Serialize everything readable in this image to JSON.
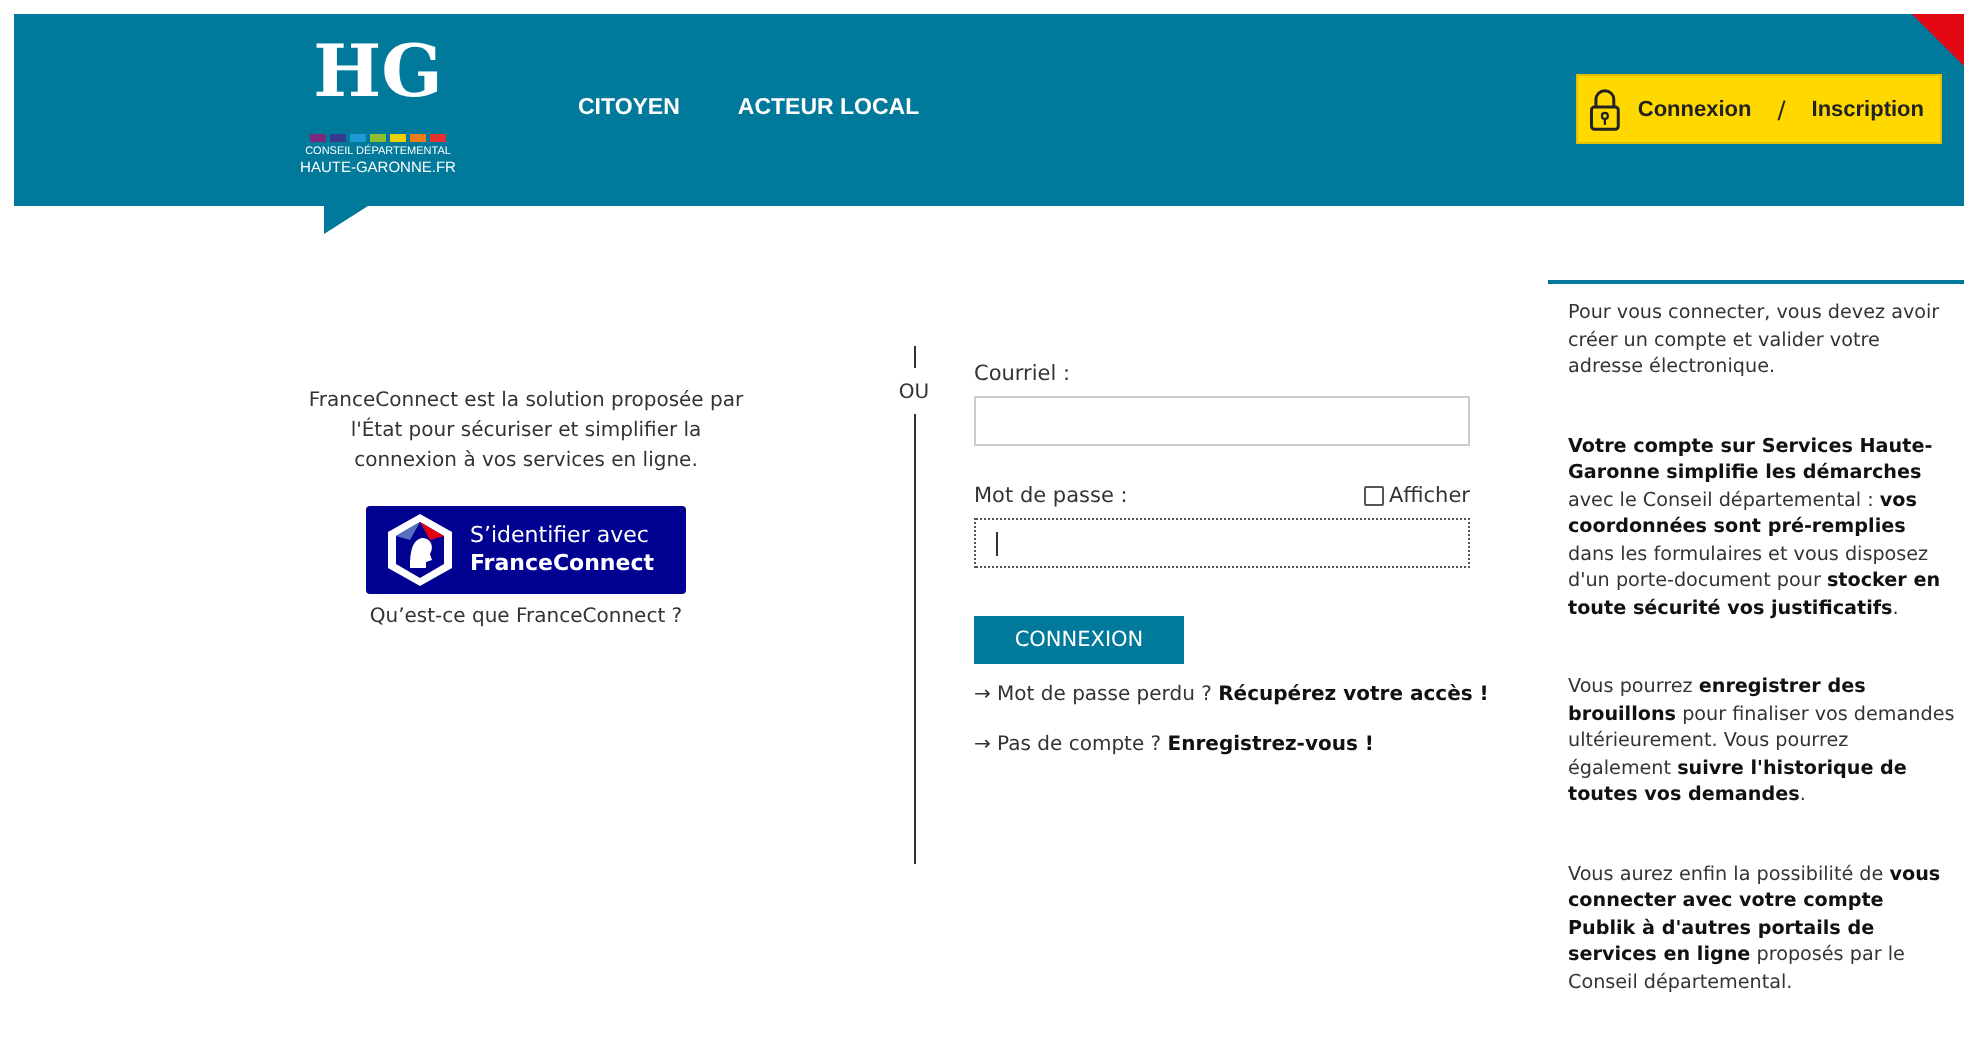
{
  "header": {
    "logo": {
      "mark": "HG",
      "line_1": "CONSEIL DÉPARTEMENTAL",
      "line_2": "HAUTE-GARONNE.FR"
    },
    "nav": [
      {
        "label": "CITOYEN"
      },
      {
        "label": "ACTEUR LOCAL"
      }
    ],
    "account": {
      "login": "Connexion",
      "separator": "/",
      "register": "Inscription"
    }
  },
  "franceconnect": {
    "intro": "FranceConnect est la solution proposée par l'État pour sécuriser et simplifier la connexion à vos services en ligne.",
    "button_line_1": "S’identifier avec",
    "button_line_2": "FranceConnect",
    "help_link": "Qu’est-ce que FranceConnect ?"
  },
  "separator": "OU",
  "form": {
    "email_label": "Courriel :",
    "password_label": "Mot de passe :",
    "show_password": {
      "label": "Afficher",
      "checked": false
    },
    "password_focused": true,
    "submit": "CONNEXION",
    "links": [
      {
        "arrow": "→",
        "text": "Mot de passe perdu ?",
        "link": "Récupérez votre accès !"
      },
      {
        "arrow": "→",
        "text": "Pas de compte ?",
        "link": "Enregistrez-vous !"
      }
    ]
  },
  "sidebar": {
    "paragraphs": [
      "Pour vous connecter, vous devez avoir créer un compte et valider votre adresse électronique.",
      "**Votre compte sur Services Haute-Garonne simplifie les démarches** avec le Conseil départemental : **vos coordonnées sont pré-remplies** dans les formulaires et vous disposez d'un porte-document pour **stocker en toute sécurité vos justificatifs**.",
      "Vous pourrez **enregistrer des brouillons** pour finaliser vos demandes ultérieurement. Vous pourrez également **suivre l'historique de toutes vos demandes**.",
      "Vous aurez enfin la possibilité de **vous connecter avec votre compte Publik à d'autres portails de services en ligne** proposés par le Conseil départemental."
    ]
  }
}
